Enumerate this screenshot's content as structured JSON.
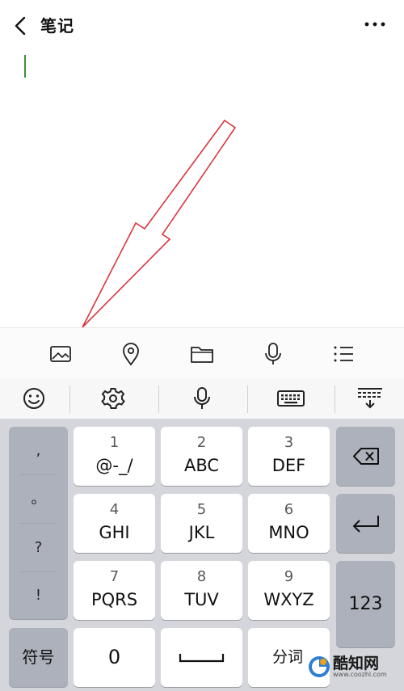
{
  "header": {
    "title": "笔记"
  },
  "toolbar": {
    "items": [
      {
        "icon": "image-icon"
      },
      {
        "icon": "location-pin-icon"
      },
      {
        "icon": "folder-icon"
      },
      {
        "icon": "microphone-icon"
      },
      {
        "icon": "list-icon"
      }
    ]
  },
  "ime_bar": {
    "items": [
      {
        "icon": "emoji-icon"
      },
      {
        "icon": "settings-icon"
      },
      {
        "icon": "voice-input-icon"
      },
      {
        "icon": "keyboard-icon"
      },
      {
        "icon": "hide-keyboard-icon"
      }
    ]
  },
  "keyboard": {
    "punctuation": [
      ",",
      "。",
      "?",
      "!"
    ],
    "keys": [
      {
        "num": "1",
        "letters": "@-_/"
      },
      {
        "num": "2",
        "letters": "ABC"
      },
      {
        "num": "3",
        "letters": "DEF"
      },
      {
        "num": "4",
        "letters": "GHI"
      },
      {
        "num": "5",
        "letters": "JKL"
      },
      {
        "num": "6",
        "letters": "MNO"
      },
      {
        "num": "7",
        "letters": "PQRS"
      },
      {
        "num": "8",
        "letters": "TUV"
      },
      {
        "num": "9",
        "letters": "WXYZ"
      }
    ],
    "symbol_label": "符号",
    "zero_label": "0",
    "num_mode_label": "123",
    "segment_label": "分词"
  },
  "watermark": {
    "text": "酷知网",
    "url": "www.coozhi.com"
  },
  "colors": {
    "annotation": "#d9363e",
    "caret": "#3b8f3b",
    "keyboard_bg": "#d4d6db",
    "fn_key": "#acb1bb"
  }
}
